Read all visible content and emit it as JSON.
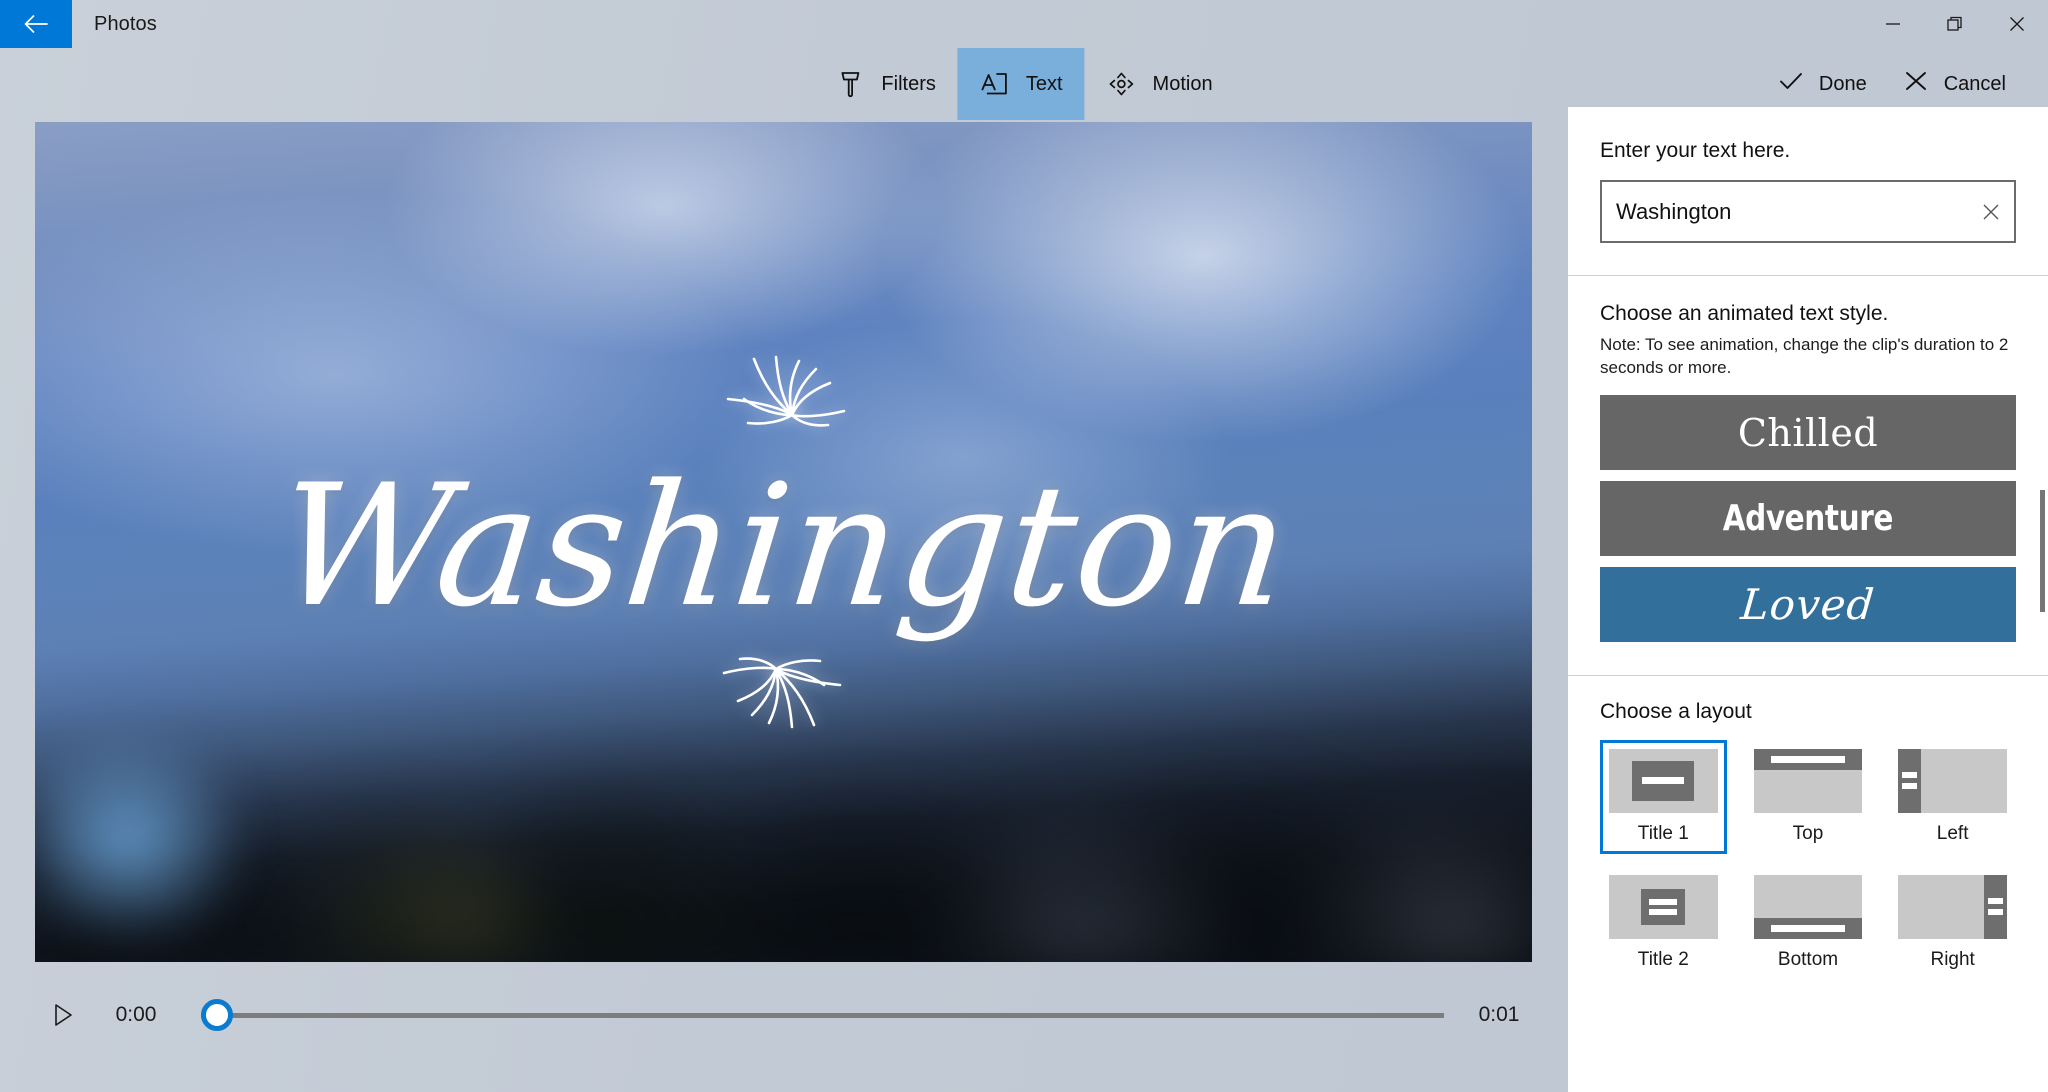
{
  "window": {
    "app_title": "Photos",
    "back_icon": "back-arrow-icon",
    "minimize_label": "Minimize",
    "restore_label": "Restore",
    "close_label": "Close"
  },
  "toolbar": {
    "tabs": [
      {
        "label": "Filters",
        "icon": "brush-icon",
        "selected": false
      },
      {
        "label": "Text",
        "icon": "text-box-icon",
        "selected": true
      },
      {
        "label": "Motion",
        "icon": "motion-pan-icon",
        "selected": false
      }
    ],
    "actions": [
      {
        "label": "Done",
        "icon": "checkmark-icon"
      },
      {
        "label": "Cancel",
        "icon": "close-x-icon"
      }
    ]
  },
  "preview": {
    "overlay_title": "Washington",
    "top_ornament": "flourish-burst-icon",
    "bottom_ornament": "flourish-burst-icon"
  },
  "transport": {
    "play_icon": "play-triangle-icon",
    "current_time": "0:00",
    "total_time": "0:01",
    "scrub_position_percent": 0
  },
  "panel": {
    "text_section": {
      "title": "Enter your text here.",
      "input_value": "Washington",
      "input_placeholder": "Enter your text here.",
      "clear_icon": "clear-x-icon"
    },
    "style_section": {
      "title": "Choose an animated text style.",
      "note": "Note: To see animation, change the clip's duration to 2 seconds or more.",
      "styles": [
        {
          "label": "Chilled",
          "selected": false,
          "bg": "#666666"
        },
        {
          "label": "Adventure",
          "selected": false,
          "bg": "#666666"
        },
        {
          "label": "Loved",
          "selected": true,
          "bg": "#336f9b"
        }
      ]
    },
    "layout_section": {
      "title": "Choose a layout",
      "layouts": [
        {
          "label": "Title 1",
          "kind": "center-one",
          "selected": true
        },
        {
          "label": "Top",
          "kind": "strip-top",
          "selected": false
        },
        {
          "label": "Left",
          "kind": "strip-left",
          "selected": false
        },
        {
          "label": "Title 2",
          "kind": "center-two",
          "selected": false
        },
        {
          "label": "Bottom",
          "kind": "strip-bottom",
          "selected": false
        },
        {
          "label": "Right",
          "kind": "strip-right",
          "selected": false
        }
      ]
    }
  },
  "colors": {
    "accent_blue": "#0078d7",
    "tab_selected_blue": "#7aaedb",
    "titlebar_gray": "#c3cbd6",
    "tile_gray": "#666666",
    "tile_selected_blue": "#336f9b",
    "panel_white": "#ffffff"
  }
}
